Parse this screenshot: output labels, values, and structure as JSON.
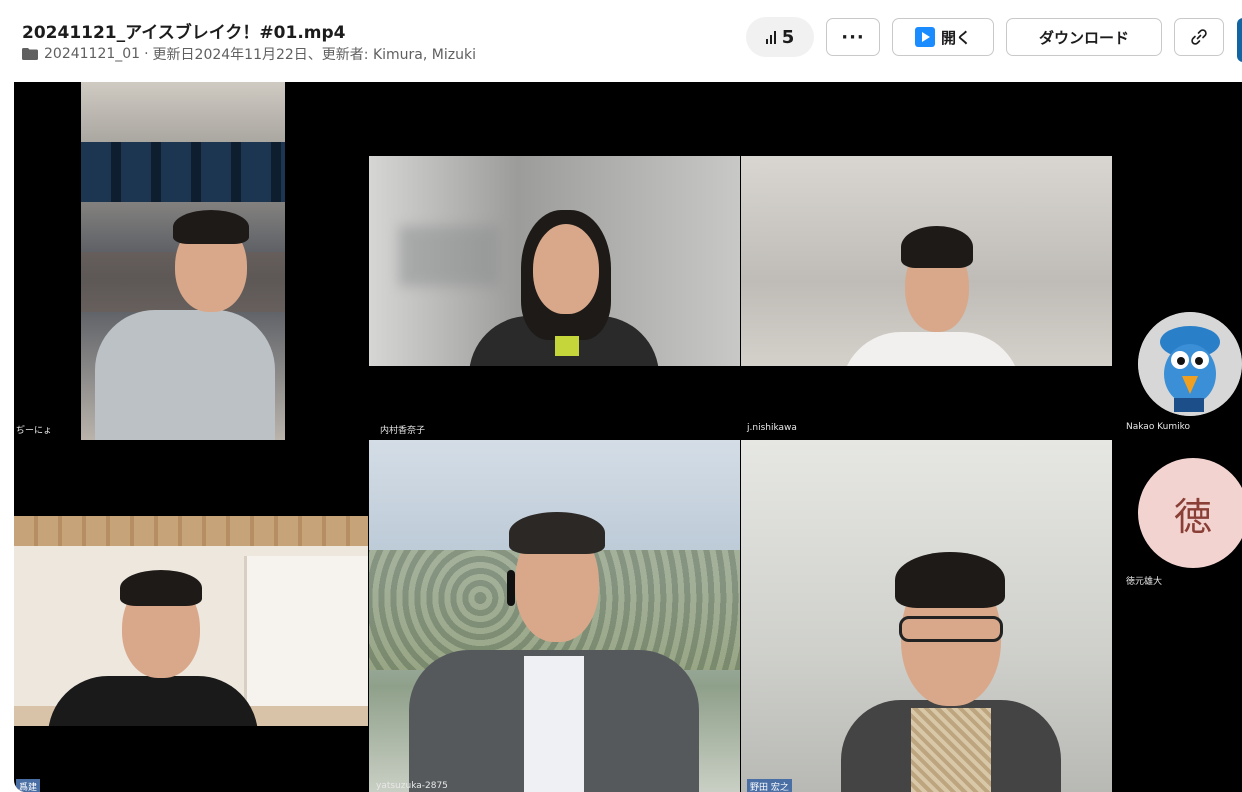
{
  "file": {
    "title": "20241121_アイスブレイク！#01.mp4",
    "folder": "20241121_01",
    "separator": "·",
    "updated": "更新日2024年11月22日、更新者: Kimura, Mizuki"
  },
  "toolbar": {
    "view_count": "5",
    "more_label": "···",
    "open_label": "開く",
    "download_label": "ダウンロード"
  },
  "participants": {
    "p1": "ぢーにょ",
    "p2": "内村香奈子",
    "p3": "j.nishikawa",
    "p4": "Nakao Kumiko",
    "p5": "徳元雄大",
    "p5_avatar": "徳",
    "p6": "爲建",
    "p7": "yatsuzuka-2875",
    "p8": "野田 宏之"
  },
  "colors": {
    "avatar_pink": "#f2d3d0",
    "accent_blue": "#1264a3",
    "open_icon": "#1a8cff"
  }
}
